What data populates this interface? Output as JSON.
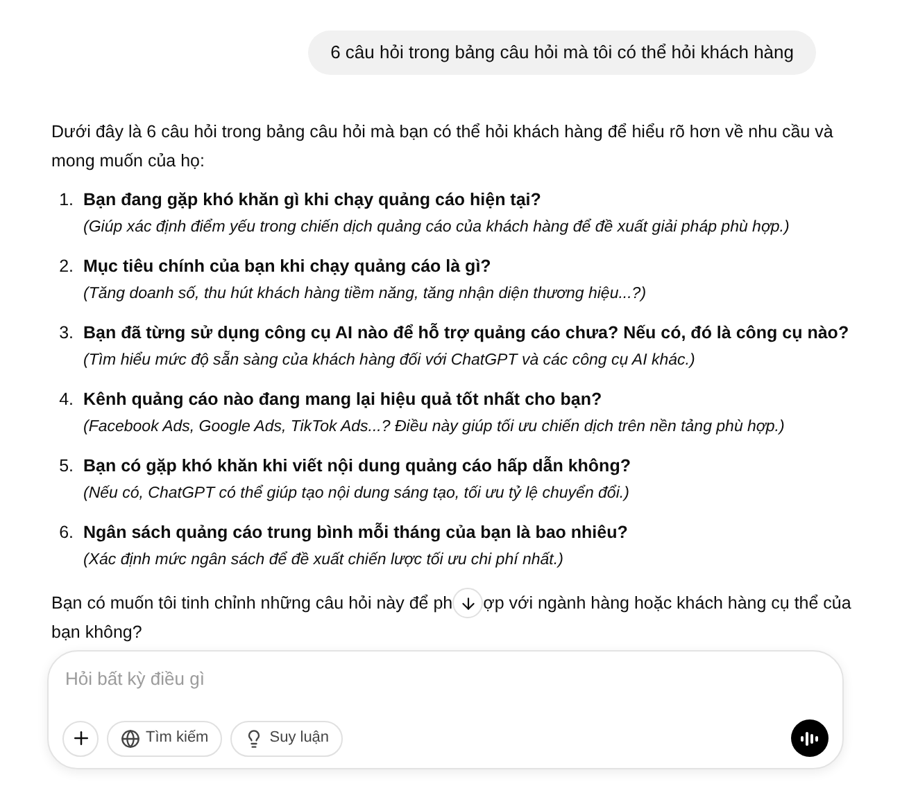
{
  "user_message": "6 câu hỏi trong bảng câu hỏi mà tôi có thể hỏi khách hàng",
  "reply": {
    "intro": "Dưới đây là 6 câu hỏi trong bảng câu hỏi mà bạn có thể hỏi khách hàng để hiểu rõ hơn về nhu cầu và mong muốn của họ:",
    "items": [
      {
        "number": "1.",
        "question": "Bạn đang gặp khó khăn gì khi chạy quảng cáo hiện tại?",
        "note": "(Giúp xác định điểm yếu trong chiến dịch quảng cáo của khách hàng để đề xuất giải pháp phù hợp.)"
      },
      {
        "number": "2.",
        "question": "Mục tiêu chính của bạn khi chạy quảng cáo là gì?",
        "note": "(Tăng doanh số, thu hút khách hàng tiềm năng, tăng nhận diện thương hiệu...?)"
      },
      {
        "number": "3.",
        "question": "Bạn đã từng sử dụng công cụ AI nào để hỗ trợ quảng cáo chưa? Nếu có, đó là công cụ nào?",
        "note": "(Tìm hiểu mức độ sẵn sàng của khách hàng đối với ChatGPT và các công cụ AI khác.)"
      },
      {
        "number": "4.",
        "question": "Kênh quảng cáo nào đang mang lại hiệu quả tốt nhất cho bạn?",
        "note": "(Facebook Ads, Google Ads, TikTok Ads...? Điều này giúp tối ưu chiến dịch trên nền tảng phù hợp.)"
      },
      {
        "number": "5.",
        "question": "Bạn có gặp khó khăn khi viết nội dung quảng cáo hấp dẫn không?",
        "note": "(Nếu có, ChatGPT có thể giúp tạo nội dung sáng tạo, tối ưu tỷ lệ chuyển đổi.)"
      },
      {
        "number": "6.",
        "question": "Ngân sách quảng cáo trung bình mỗi tháng của bạn là bao nhiêu?",
        "note": "(Xác định mức ngân sách để đề xuất chiến lược tối ưu chi phí nhất.)"
      }
    ],
    "closing_before": "Bạn có muốn tôi tinh chỉnh những câu hỏi này để ph",
    "closing_after_lines": [
      "ợp với ngành hàng hoặc khách hàng cụ thể của",
      "bạn không?"
    ]
  },
  "composer": {
    "placeholder": "Hỏi bất kỳ điều gì",
    "buttons": [
      {
        "kind": "search",
        "label": "Tìm kiếm"
      },
      {
        "kind": "reason",
        "label": "Suy luận"
      }
    ]
  }
}
